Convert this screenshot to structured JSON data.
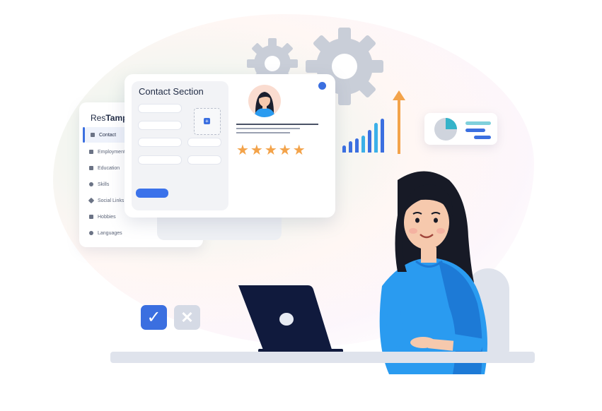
{
  "brand": {
    "prefix": "Res",
    "bold": "Tampl"
  },
  "sidebar": {
    "items": [
      {
        "label": "Contact",
        "icon": "user-icon"
      },
      {
        "label": "Employment",
        "icon": "briefcase-icon"
      },
      {
        "label": "Education",
        "icon": "education-icon"
      },
      {
        "label": "Skills",
        "icon": "star-icon"
      },
      {
        "label": "Social Links",
        "icon": "send-icon"
      },
      {
        "label": "Hobbies",
        "icon": "hobby-icon"
      },
      {
        "label": "Languages",
        "icon": "globe-icon"
      }
    ]
  },
  "contact": {
    "title": "Contact Section"
  },
  "rating": {
    "stars": "★★★★★",
    "value": 5,
    "max": 5
  },
  "icons": {
    "check": "✓",
    "cross": "✕"
  },
  "colors": {
    "accent": "#3b6fe0",
    "star": "#f3a34a",
    "sweater": "#2a9bf0",
    "laptop": "#101a3d",
    "gear": "#c9ced8"
  }
}
